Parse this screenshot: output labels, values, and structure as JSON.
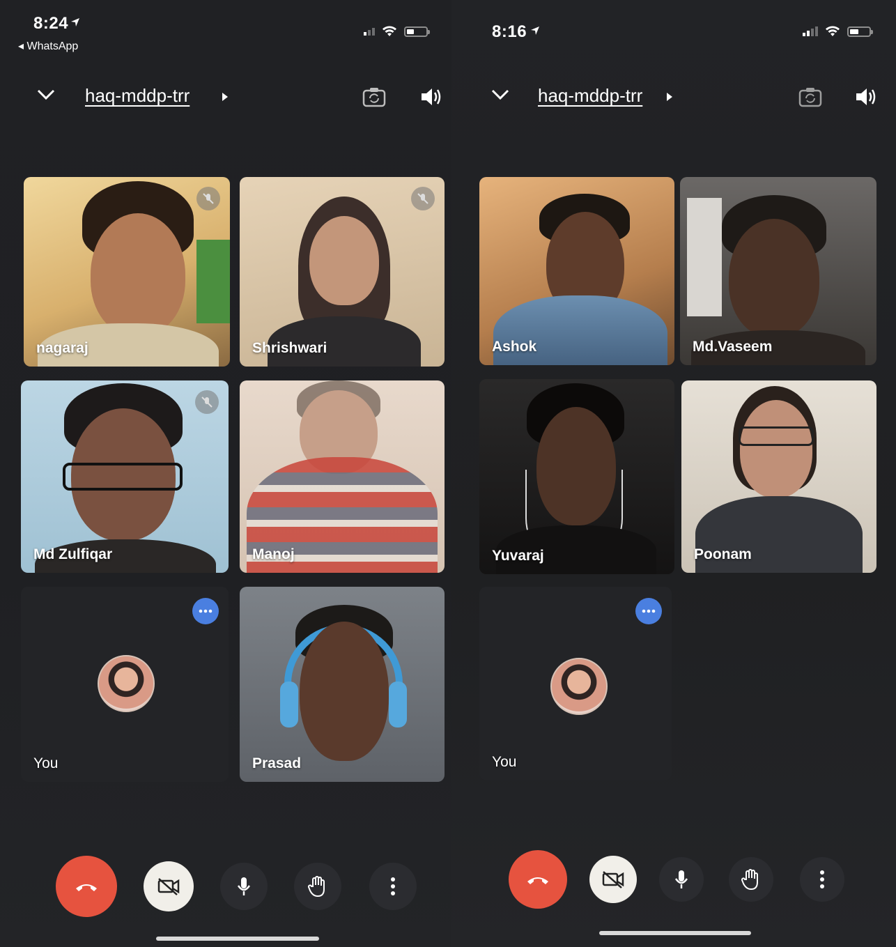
{
  "left_screen": {
    "status": {
      "time": "8:24",
      "back_label": "◂ WhatsApp"
    },
    "header": {
      "meeting_code": "haq-mddp-trr"
    },
    "participants": [
      "nagaraj",
      "Shrishwari",
      "Md Zulfiqar",
      "Manoj",
      "You",
      "Prasad"
    ]
  },
  "right_screen": {
    "status": {
      "time": "8:16"
    },
    "header": {
      "meeting_code": "haq-mddp-trr"
    },
    "participants": [
      "Ashok",
      "Md.Vaseem",
      "Yuvaraj",
      "Poonam",
      "You"
    ]
  },
  "colors": {
    "end_call": "#e6533f",
    "more_options": "#4a7fe0",
    "background": "#202124"
  },
  "icons": [
    "chevron-down-icon",
    "switch-camera-icon",
    "speaker-icon",
    "mic-off-icon",
    "more-horizontal-icon",
    "end-call-icon",
    "camera-off-icon",
    "mic-icon",
    "raise-hand-icon",
    "more-vertical-icon"
  ]
}
